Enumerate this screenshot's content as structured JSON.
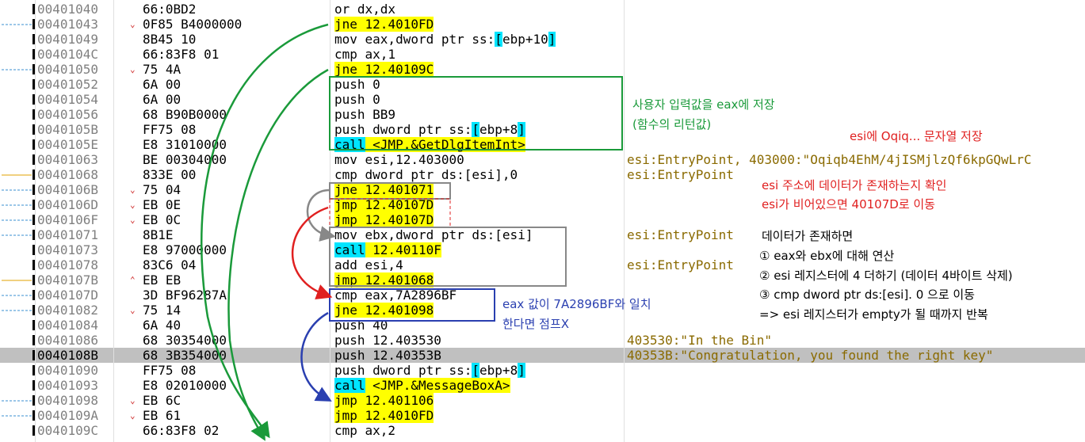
{
  "rows": [
    {
      "addr": "00401040",
      "mark": "",
      "bytes": "66:0BD2",
      "instr": [
        {
          "t": "or dx,dx",
          "c": ""
        }
      ],
      "comment": ""
    },
    {
      "addr": "00401043",
      "mark": "v",
      "bytes": "0F85 B4000000",
      "instr": [
        {
          "t": "jne",
          "c": "hlj"
        },
        {
          "t": " 12.4010FD",
          "c": "hlj"
        }
      ],
      "comment": ""
    },
    {
      "addr": "00401049",
      "mark": "",
      "bytes": "8B45 10",
      "instr": [
        {
          "t": "mov eax,dword ptr ss:",
          "c": ""
        },
        {
          "t": "[",
          "c": "hlb"
        },
        {
          "t": "ebp+10",
          "c": ""
        },
        {
          "t": "]",
          "c": "hlb"
        }
      ],
      "comment": ""
    },
    {
      "addr": "0040104C",
      "mark": "",
      "bytes": "66:83F8 01",
      "instr": [
        {
          "t": "cmp ax,1",
          "c": ""
        }
      ],
      "comment": ""
    },
    {
      "addr": "00401050",
      "mark": "v",
      "bytes": "75 4A",
      "instr": [
        {
          "t": "jne",
          "c": "hlj"
        },
        {
          "t": " 12.40109C",
          "c": "hlj"
        }
      ],
      "comment": ""
    },
    {
      "addr": "00401052",
      "mark": "",
      "bytes": "6A 00",
      "instr": [
        {
          "t": "push 0",
          "c": ""
        }
      ],
      "comment": ""
    },
    {
      "addr": "00401054",
      "mark": "",
      "bytes": "6A 00",
      "instr": [
        {
          "t": "push 0",
          "c": ""
        }
      ],
      "comment": ""
    },
    {
      "addr": "00401056",
      "mark": "",
      "bytes": "68 B90B0000",
      "instr": [
        {
          "t": "push BB9",
          "c": ""
        }
      ],
      "comment": ""
    },
    {
      "addr": "0040105B",
      "mark": "",
      "bytes": "FF75 08",
      "instr": [
        {
          "t": "push dword ptr ss:",
          "c": ""
        },
        {
          "t": "[",
          "c": "hlb"
        },
        {
          "t": "ebp+8",
          "c": ""
        },
        {
          "t": "]",
          "c": "hlb"
        }
      ],
      "comment": ""
    },
    {
      "addr": "0040105E",
      "mark": "",
      "bytes": "E8 31010000",
      "instr": [
        {
          "t": "call",
          "c": "hlc"
        },
        {
          "t": " <JMP.&GetDlgItemInt>",
          "c": "hlj"
        }
      ],
      "comment": ""
    },
    {
      "addr": "00401063",
      "mark": "",
      "bytes": "BE 00304000",
      "instr": [
        {
          "t": "mov esi,12.403000",
          "c": ""
        }
      ],
      "comment": "esi:EntryPoint, 403000:\"Oqiqb4EhM/4jISMjlzQf6kpGQwLrC"
    },
    {
      "addr": "00401068",
      "mark": "",
      "bytes": "833E 00",
      "instr": [
        {
          "t": "cmp dword ptr ds:[esi],0",
          "c": ""
        }
      ],
      "comment": "esi:EntryPoint"
    },
    {
      "addr": "0040106B",
      "mark": "v",
      "bytes": "75 04",
      "instr": [
        {
          "t": "jne",
          "c": "hlj"
        },
        {
          "t": " 12.401071",
          "c": "hlj"
        }
      ],
      "comment": ""
    },
    {
      "addr": "0040106D",
      "mark": "v",
      "bytes": "EB 0E",
      "instr": [
        {
          "t": "jmp",
          "c": "hlj"
        },
        {
          "t": " 12.40107D",
          "c": "hlj"
        }
      ],
      "comment": ""
    },
    {
      "addr": "0040106F",
      "mark": "v",
      "bytes": "EB 0C",
      "instr": [
        {
          "t": "jmp",
          "c": "hlj"
        },
        {
          "t": " 12.40107D",
          "c": "hlj"
        }
      ],
      "comment": ""
    },
    {
      "addr": "00401071",
      "mark": "",
      "bytes": "8B1E",
      "instr": [
        {
          "t": "mov ebx,dword ptr ds:[esi]",
          "c": ""
        }
      ],
      "comment": "esi:EntryPoint"
    },
    {
      "addr": "00401073",
      "mark": "",
      "bytes": "E8 97000000",
      "instr": [
        {
          "t": "call",
          "c": "hlc"
        },
        {
          "t": " 12.40110F",
          "c": "hlj"
        }
      ],
      "comment": ""
    },
    {
      "addr": "00401078",
      "mark": "",
      "bytes": "83C6 04",
      "instr": [
        {
          "t": "add esi,4",
          "c": ""
        }
      ],
      "comment": "esi:EntryPoint"
    },
    {
      "addr": "0040107B",
      "mark": "^",
      "bytes": "EB EB",
      "instr": [
        {
          "t": "jmp",
          "c": "hlj"
        },
        {
          "t": " 12.401068",
          "c": "hlj"
        }
      ],
      "comment": ""
    },
    {
      "addr": "0040107D",
      "mark": "",
      "bytes": "3D BF96287A",
      "instr": [
        {
          "t": "cmp eax,7A2896BF",
          "c": ""
        }
      ],
      "comment": ""
    },
    {
      "addr": "00401082",
      "mark": "v",
      "bytes": "75 14",
      "instr": [
        {
          "t": "jne",
          "c": "hlj"
        },
        {
          "t": " 12.401098",
          "c": "hlj"
        }
      ],
      "comment": ""
    },
    {
      "addr": "00401084",
      "mark": "",
      "bytes": "6A 40",
      "instr": [
        {
          "t": "push 40",
          "c": ""
        }
      ],
      "comment": ""
    },
    {
      "addr": "00401086",
      "mark": "",
      "bytes": "68 30354000",
      "instr": [
        {
          "t": "push 12.403530",
          "c": ""
        }
      ],
      "comment": "403530:\"In the Bin\""
    },
    {
      "addr": "0040108B",
      "mark": "",
      "bytes": "68 3B354000",
      "instr": [
        {
          "t": "push 12.40353B",
          "c": ""
        }
      ],
      "comment": "40353B:\"Congratulation, you found the right key\"",
      "selected": true
    },
    {
      "addr": "00401090",
      "mark": "",
      "bytes": "FF75 08",
      "instr": [
        {
          "t": "push dword ptr ss:",
          "c": ""
        },
        {
          "t": "[",
          "c": "hlb"
        },
        {
          "t": "ebp+8",
          "c": ""
        },
        {
          "t": "]",
          "c": "hlb"
        }
      ],
      "comment": ""
    },
    {
      "addr": "00401093",
      "mark": "",
      "bytes": "E8 02010000",
      "instr": [
        {
          "t": "call",
          "c": "hlc"
        },
        {
          "t": " <JMP.&MessageBoxA>",
          "c": "hlj"
        }
      ],
      "comment": ""
    },
    {
      "addr": "00401098",
      "mark": "v",
      "bytes": "EB 6C",
      "instr": [
        {
          "t": "jmp",
          "c": "hlj"
        },
        {
          "t": " 12.401106",
          "c": "hlj"
        }
      ],
      "comment": ""
    },
    {
      "addr": "0040109A",
      "mark": "v",
      "bytes": "EB 61",
      "instr": [
        {
          "t": "jmp",
          "c": "hlj"
        },
        {
          "t": " 12.4010FD",
          "c": "hlj"
        }
      ],
      "comment": ""
    },
    {
      "addr": "0040109C",
      "mark": "",
      "bytes": "66:83F8 02",
      "instr": [
        {
          "t": "cmp ax,2",
          "c": ""
        }
      ],
      "comment": ""
    }
  ],
  "annotations": {
    "green_line1": "사용자 입력값을 eax에 저장",
    "green_line2": "(함수의 리턴값)",
    "red_top": "esi에 Oqiq... 문자열 저장",
    "red_line1": "esi 주소에 데이터가 존재하는지 확인",
    "red_line2": "esi가 비어있으면 40107D로 이동",
    "black_1": "데이터가 존재하면",
    "black_2": "① eax와 ebx에 대해 연산",
    "black_3": "② esi 레지스터에 4 더하기 (데이터 4바이트 삭제)",
    "black_4": "③ cmp dword ptr ds:[esi]. 0 으로 이동",
    "black_5": "=> esi 레지스터가 empty가 될 때까지 반복",
    "blue_1": "eax 값이 7A2896BF와 일치",
    "blue_2": "한다면 점프X"
  },
  "colors": {
    "jump_highlight": "#ffff00",
    "call_highlight": "#00e5ff",
    "selected_row": "#c0c0c0",
    "annotation_green": "#1a9a3a",
    "annotation_red": "#e02020",
    "annotation_blue": "#2a3fb0",
    "comment_text": "#8a6a00"
  }
}
